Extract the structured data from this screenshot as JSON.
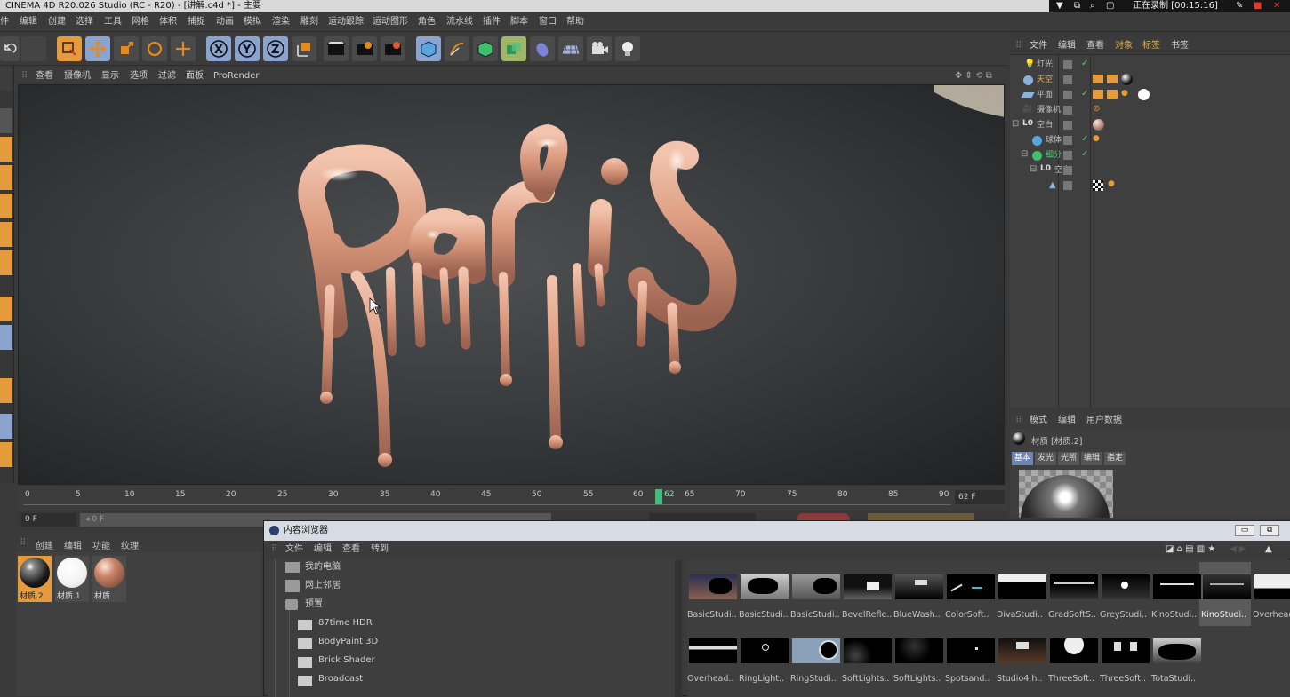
{
  "window": {
    "title": "CINEMA 4D R20.026 Studio (RC - R20) - [讲解.c4d *] - 主要",
    "recording": "正在录制 [00:15:16]"
  },
  "menubar": [
    "件",
    "编辑",
    "创建",
    "选择",
    "工具",
    "网格",
    "体积",
    "捕捉",
    "动画",
    "模拟",
    "渲染",
    "雕刻",
    "运动跟踪",
    "运动图形",
    "角色",
    "流水线",
    "插件",
    "脚本",
    "窗口",
    "帮助"
  ],
  "viewport": {
    "menu": [
      "查看",
      "摄像机",
      "显示",
      "选项",
      "过滤",
      "面板",
      "ProRender"
    ]
  },
  "timeline": {
    "ticks": [
      "0",
      "5",
      "10",
      "15",
      "20",
      "25",
      "30",
      "35",
      "40",
      "45",
      "50",
      "55",
      "60",
      "62",
      "65",
      "70",
      "75",
      "80",
      "85",
      "90"
    ],
    "end_field": "62 F",
    "current_field": "0 F",
    "start_field": "0 F",
    "current_frame": 62
  },
  "material_manager": {
    "menu": [
      "创建",
      "编辑",
      "功能",
      "纹理"
    ],
    "materials": [
      {
        "label": "材质.2",
        "selected": true,
        "kind": "dark-glossy"
      },
      {
        "label": "材质.1",
        "selected": false,
        "kind": "white"
      },
      {
        "label": "材质",
        "selected": false,
        "kind": "copper"
      }
    ]
  },
  "object_manager": {
    "menu": [
      "文件",
      "编辑",
      "查看",
      "对象",
      "标签",
      "书签"
    ],
    "objects": [
      {
        "name": "灯光",
        "indent": 0
      },
      {
        "name": "天空",
        "indent": 0,
        "highlight": true
      },
      {
        "name": "平面",
        "indent": 0
      },
      {
        "name": "摄像机",
        "indent": 0
      },
      {
        "name": "空白",
        "indent": 0
      },
      {
        "name": "球体",
        "indent": 1
      },
      {
        "name": "细分",
        "indent": 0
      },
      {
        "name": "空白",
        "indent": 1
      },
      {
        "name": "",
        "indent": 2
      }
    ]
  },
  "attributes": {
    "menu": [
      "模式",
      "编辑",
      "用户数据"
    ],
    "object": "材质 [材质.2]",
    "tabs": [
      "基本",
      "发光",
      "光照",
      "编辑",
      "指定"
    ],
    "active_tab": "基本"
  },
  "content_browser": {
    "title": "内容浏览器",
    "menu": [
      "文件",
      "编辑",
      "查看",
      "转到"
    ],
    "tree": [
      {
        "label": "我的电脑",
        "level": 0
      },
      {
        "label": "网上邻居",
        "level": 0
      },
      {
        "label": "预置",
        "level": 0
      },
      {
        "label": "87time HDR",
        "level": 1
      },
      {
        "label": "BodyPaint 3D",
        "level": 1
      },
      {
        "label": "Brick Shader",
        "level": 1
      },
      {
        "label": "Broadcast",
        "level": 1
      }
    ],
    "items_row1": [
      "BasicStudi..",
      "BasicStudi..",
      "BasicStudi..",
      "BevelRefle..",
      "BlueWash..",
      "ColorSoft..",
      "DivaStudi..",
      "GradSoftS..",
      "GreyStudi..",
      "KinoStudi..",
      "KinoStudi..",
      "Overhead.."
    ],
    "items_row2": [
      "Overhead..",
      "RingLight..",
      "RingStudi..",
      "SoftLights..",
      "SoftLights..",
      "Spotsand..",
      "Studio4.h..",
      "ThreeSoft..",
      "ThreeSoft..",
      "TotaStudi.."
    ],
    "selected_item": 10
  },
  "colors": {
    "accent": "#e59a3c",
    "toolbar_blue": "#8aa4cf",
    "tab_blue": "#6f86b3",
    "paris_skin": "#e2a88d"
  }
}
